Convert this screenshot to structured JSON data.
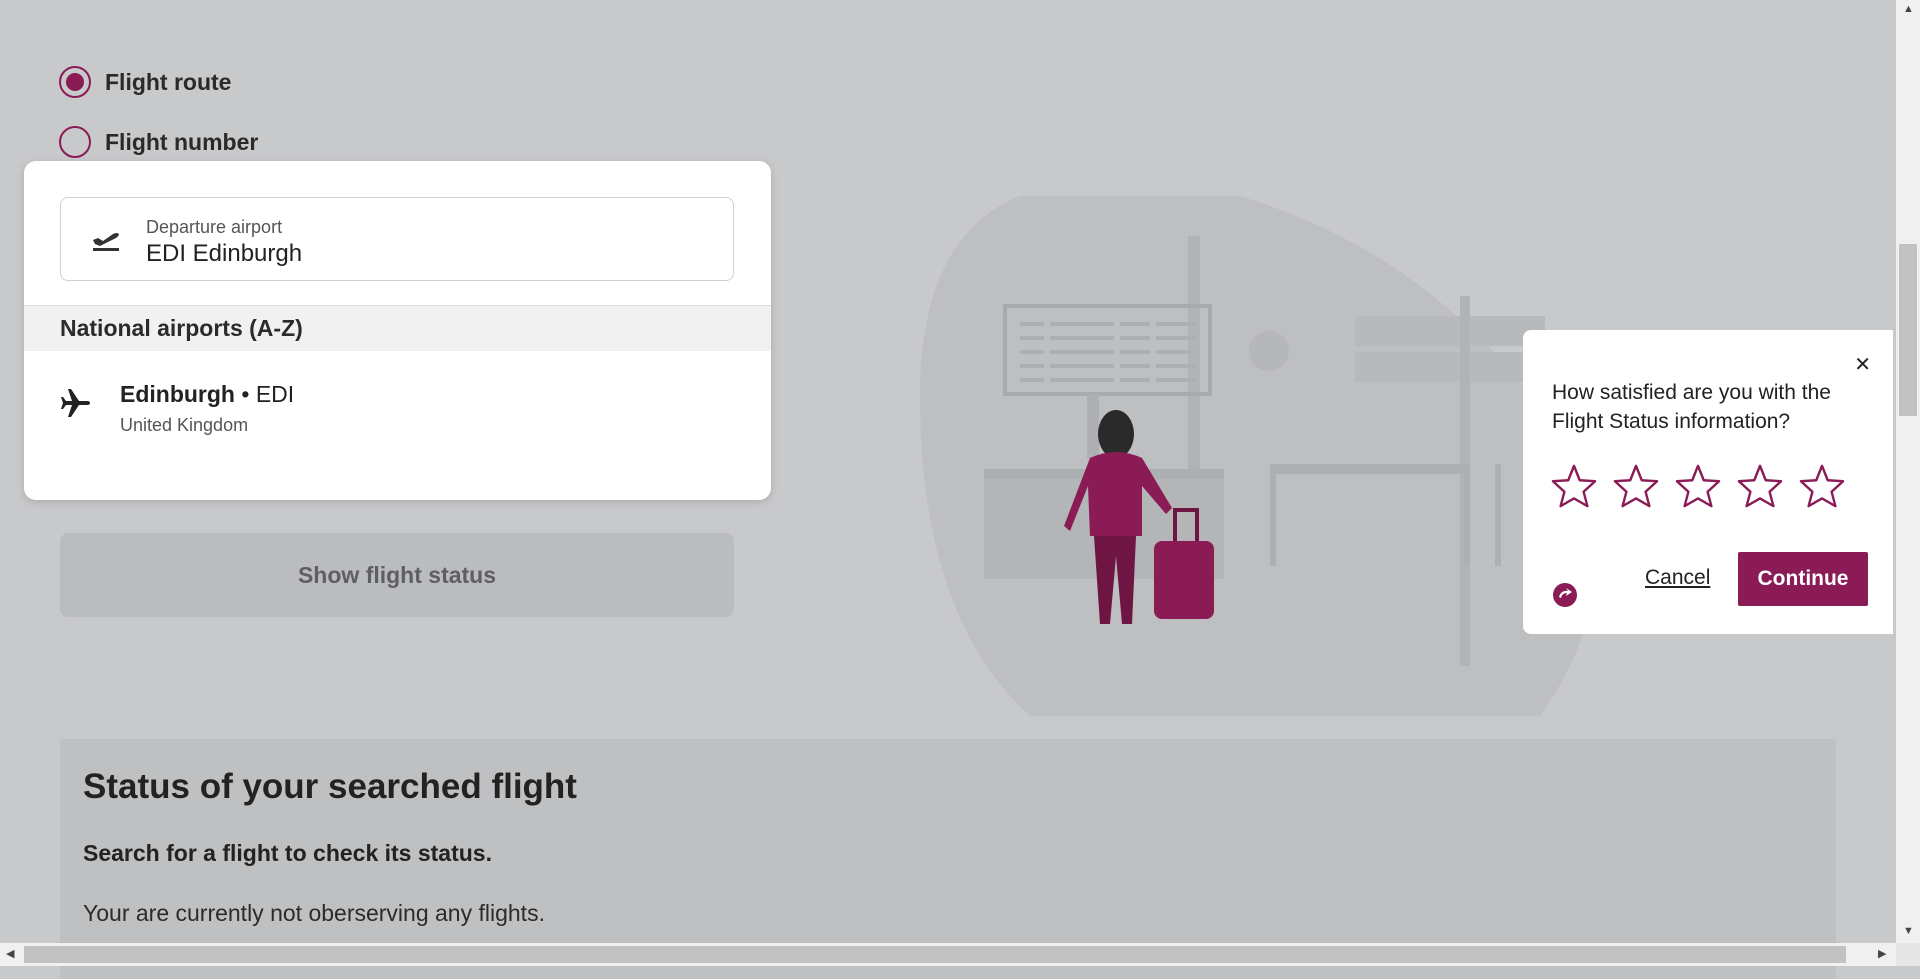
{
  "search_mode": {
    "options": [
      {
        "label": "Flight route",
        "selected": true
      },
      {
        "label": "Flight number",
        "selected": false
      }
    ]
  },
  "airport_search": {
    "field_label": "Departure airport",
    "field_value": "EDI Edinburgh",
    "section_header": "National airports (A-Z)",
    "results": [
      {
        "city": "Edinburgh",
        "separator": " • ",
        "code": "EDI",
        "country": "United Kingdom"
      }
    ]
  },
  "show_button_label": "Show flight status",
  "status": {
    "title": "Status of your searched flight",
    "subtitle": "Search for a flight to check its status.",
    "empty_message": "Your are currently not oberserving any flights."
  },
  "survey": {
    "close_glyph": "✕",
    "question": "How satisfied are you with the Flight Status information?",
    "star_count": 5,
    "rating": 0,
    "cancel_label": "Cancel",
    "continue_label": "Continue"
  },
  "colors": {
    "brand": "#8a1b55",
    "overlay_background": "#c8c9cb"
  },
  "icons": [
    "departure-icon",
    "airplane-icon",
    "star-icon",
    "close-icon",
    "brand-logo-icon"
  ]
}
